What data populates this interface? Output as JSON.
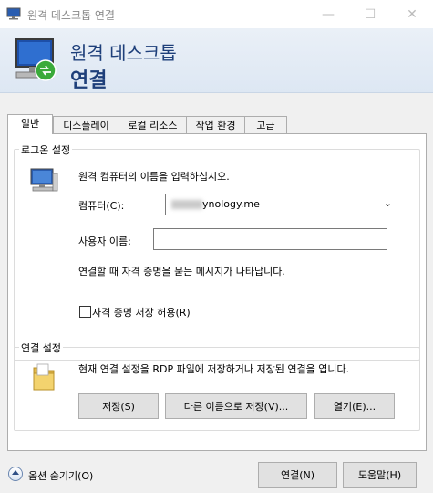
{
  "window": {
    "title": "원격 데스크톱 연결",
    "minimize": "—",
    "maximize": "☐",
    "close": "✕"
  },
  "header": {
    "line1": "원격 데스크톱",
    "line2": "연결"
  },
  "tabs": [
    "일반",
    "디스플레이",
    "로컬 리소스",
    "작업 환경",
    "고급"
  ],
  "login": {
    "group_title": "로그온 설정",
    "instruction": "원격 컴퓨터의 이름을 입력하십시오.",
    "computer_label": "컴퓨터(C):",
    "computer_value": "ynology.me",
    "username_label": "사용자 이름:",
    "username_value": "",
    "credential_note": "연결할 때 자격 증명을 묻는 메시지가 나타납니다.",
    "save_credentials_label": "자격 증명 저장 허용(R)"
  },
  "connection": {
    "group_title": "연결 설정",
    "description": "현재 연결 설정을 RDP 파일에 저장하거나 저장된 연결을 엽니다.",
    "save_button": "저장(S)",
    "save_as_button": "다른 이름으로 저장(V)...",
    "open_button": "열기(E)..."
  },
  "footer": {
    "hide_options": "옵션 숨기기(O)",
    "connect_button": "연결(N)",
    "help_button": "도움말(H)"
  }
}
